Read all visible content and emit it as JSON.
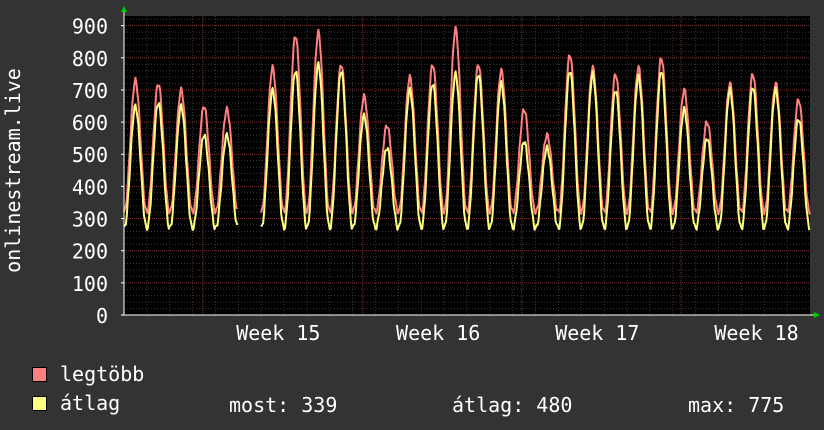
{
  "chart_data": {
    "type": "line",
    "ylabel": "onlinestream.live",
    "ylim": [
      0,
      930
    ],
    "yticks": [
      0,
      100,
      200,
      300,
      400,
      500,
      600,
      700,
      800,
      900
    ],
    "xticks": [
      {
        "label": "Week 15",
        "pos": 0.225
      },
      {
        "label": "Week 16",
        "pos": 0.458
      },
      {
        "label": "Week 17",
        "pos": 0.69
      },
      {
        "label": "Week 18",
        "pos": 0.922
      }
    ],
    "days": 30,
    "series": [
      {
        "name": "legtöbb",
        "color": "#ff7f7f",
        "daily_peaks": [
          730,
          720,
          700,
          650,
          640,
          320,
          770,
          870,
          880,
          780,
          680,
          590,
          740,
          780,
          890,
          780,
          760,
          640,
          560,
          810,
          770,
          750,
          770,
          800,
          700,
          600,
          720,
          750,
          720,
          670
        ],
        "trough": 320
      },
      {
        "name": "átlag",
        "color": "#ffff7f",
        "daily_peaks": [
          650,
          660,
          650,
          560,
          560,
          300,
          700,
          760,
          780,
          760,
          620,
          520,
          700,
          720,
          750,
          750,
          720,
          540,
          520,
          760,
          750,
          700,
          740,
          760,
          640,
          550,
          700,
          710,
          700,
          610
        ],
        "trough": 270
      }
    ]
  },
  "legend": {
    "items": [
      {
        "name": "legtöbb",
        "color": "#ff7f7f"
      },
      {
        "name": "átlag",
        "color": "#ffff7f"
      }
    ],
    "stats": [
      {
        "label": "most:",
        "value": "339"
      },
      {
        "label": "átlag:",
        "value": "480"
      },
      {
        "label": "max:",
        "value": "775"
      }
    ]
  },
  "colors": {
    "background": "#333333",
    "plot_bg": "#000000",
    "grid_minor": "#3a3a3a",
    "grid_major": "#7f3535",
    "axis": "#ffffff",
    "arrow": "#00cc00"
  }
}
